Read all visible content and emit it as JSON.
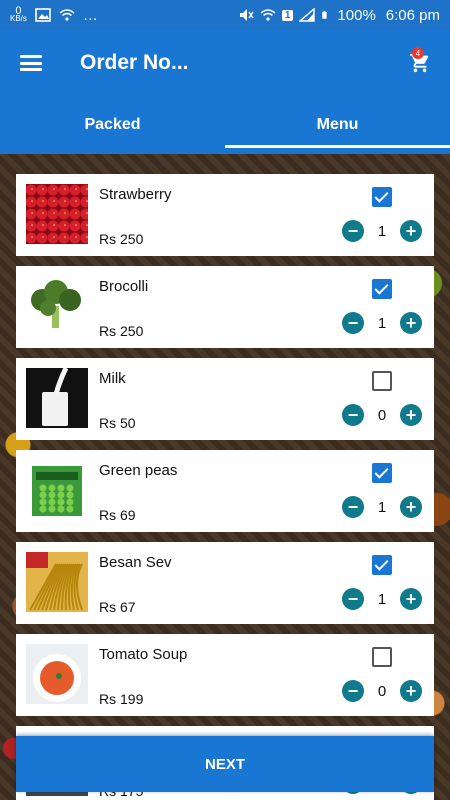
{
  "status_bar": {
    "kb_value": "0",
    "kb_unit": "KB/s",
    "sim_number": "1",
    "battery": "100%",
    "time": "6:06 pm"
  },
  "app_bar": {
    "title": "Order No...",
    "cart_count": "4",
    "menu_icon": "hamburger-menu-icon",
    "cart_icon": "shopping-cart-icon"
  },
  "tabs": [
    {
      "label": "Packed",
      "active": false
    },
    {
      "label": "Menu",
      "active": true
    }
  ],
  "items": [
    {
      "name": "Strawberry",
      "price": "Rs 250",
      "checked": true,
      "qty": "1",
      "image": "strawberry-image"
    },
    {
      "name": "Brocolli",
      "price": "Rs 250",
      "checked": true,
      "qty": "1",
      "image": "broccoli-image"
    },
    {
      "name": "Milk",
      "price": "Rs 50",
      "checked": false,
      "qty": "0",
      "image": "milk-image"
    },
    {
      "name": "Green peas",
      "price": "Rs 69",
      "checked": true,
      "qty": "1",
      "image": "green-peas-image"
    },
    {
      "name": "Besan Sev",
      "price": "Rs 67",
      "checked": true,
      "qty": "1",
      "image": "besan-sev-image"
    },
    {
      "name": "Tomato Soup",
      "price": "Rs 199",
      "checked": false,
      "qty": "0",
      "image": "tomato-soup-image"
    },
    {
      "name": "",
      "price": "Rs 175",
      "checked": false,
      "qty": "",
      "image": "partially-hidden-item-image"
    }
  ],
  "qty_controls": {
    "minus": "−",
    "plus": "+"
  },
  "next_button": {
    "label": "NEXT"
  },
  "colors": {
    "primary": "#1976d2",
    "qty_button": "#0e7a8c",
    "badge": "#e53935"
  }
}
